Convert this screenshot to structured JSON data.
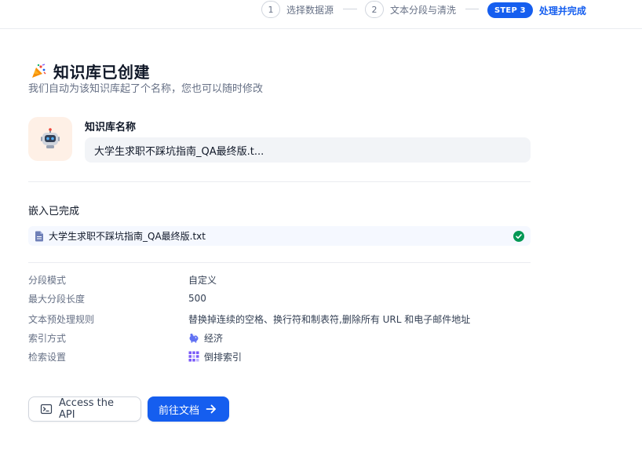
{
  "stepper": {
    "steps": [
      {
        "number": "1",
        "label": "选择数据源"
      },
      {
        "number": "2",
        "label": "文本分段与清洗"
      }
    ],
    "active": {
      "badge": "STEP 3",
      "label": "处理并完成"
    }
  },
  "header": {
    "title": "知识库已创建",
    "subtitle": "我们自动为该知识库起了个名称，您也可以随时修改"
  },
  "kb": {
    "name_label": "知识库名称",
    "name_value": "大学生求职不踩坑指南_QA最终版.t..."
  },
  "embedding": {
    "title": "嵌入已完成",
    "file_name": "大学生求职不踩坑指南_QA最终版.txt"
  },
  "info": [
    {
      "key": "分段模式",
      "value": "自定义",
      "icon": ""
    },
    {
      "key": "最大分段长度",
      "value": "500",
      "icon": ""
    },
    {
      "key": "文本预处理规则",
      "value": "替换掉连续的空格、换行符和制表符,删除所有 URL 和电子邮件地址",
      "icon": ""
    },
    {
      "key": "索引方式",
      "value": "经济",
      "icon": "piggy-bank-icon"
    },
    {
      "key": "检索设置",
      "value": "倒排索引",
      "icon": "grid-icon"
    }
  ],
  "actions": {
    "api_label": "Access the API",
    "docs_label": "前往文档"
  },
  "colors": {
    "accent": "#155eef",
    "success": "#039855",
    "avatar_bg": "#fef0e6"
  }
}
